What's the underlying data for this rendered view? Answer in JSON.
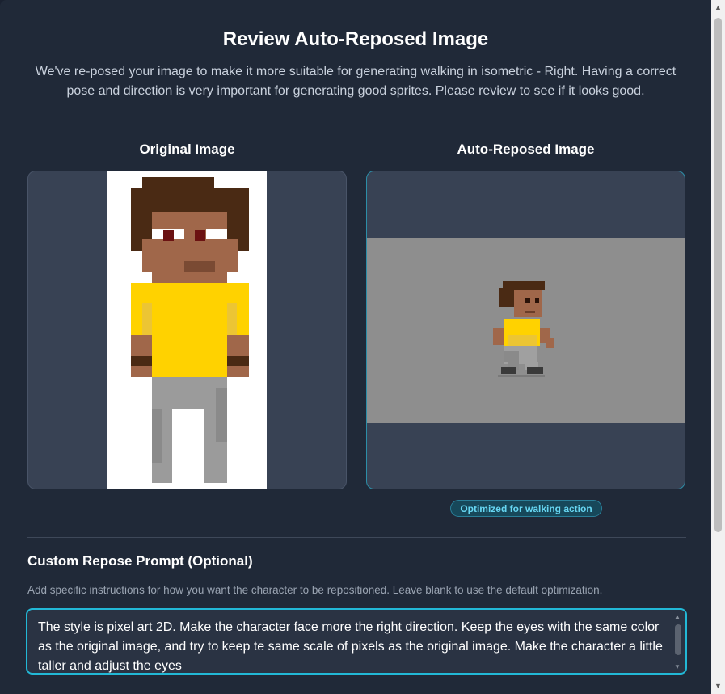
{
  "dialog": {
    "title": "Review Auto-Reposed Image",
    "subtitle": "We've re-posed your image to make it more suitable for generating walking in isometric - Right. Having a correct pose and direction is very important for generating good sprites. Please review to see if it looks good."
  },
  "original": {
    "label": "Original Image"
  },
  "reposed": {
    "label": "Auto-Reposed Image",
    "badge": "Optimized for walking action"
  },
  "custom_prompt": {
    "title": "Custom Repose Prompt (Optional)",
    "help": "Add specific instructions for how you want the character to be repositioned. Leave blank to use the default optimization.",
    "value": "The style is pixel art 2D. Make the character face more the right direction. Keep the eyes with the same color as the original image, and try to keep te same scale of pixels as the original image. Make the character a little taller and adjust the eyes"
  },
  "colors": {
    "accent": "#22b8d6",
    "skin": "#a0674a",
    "hair": "#4a2a14",
    "shirt": "#ffd200",
    "pants": "#9b9b9b",
    "eye": "#6b1212"
  }
}
